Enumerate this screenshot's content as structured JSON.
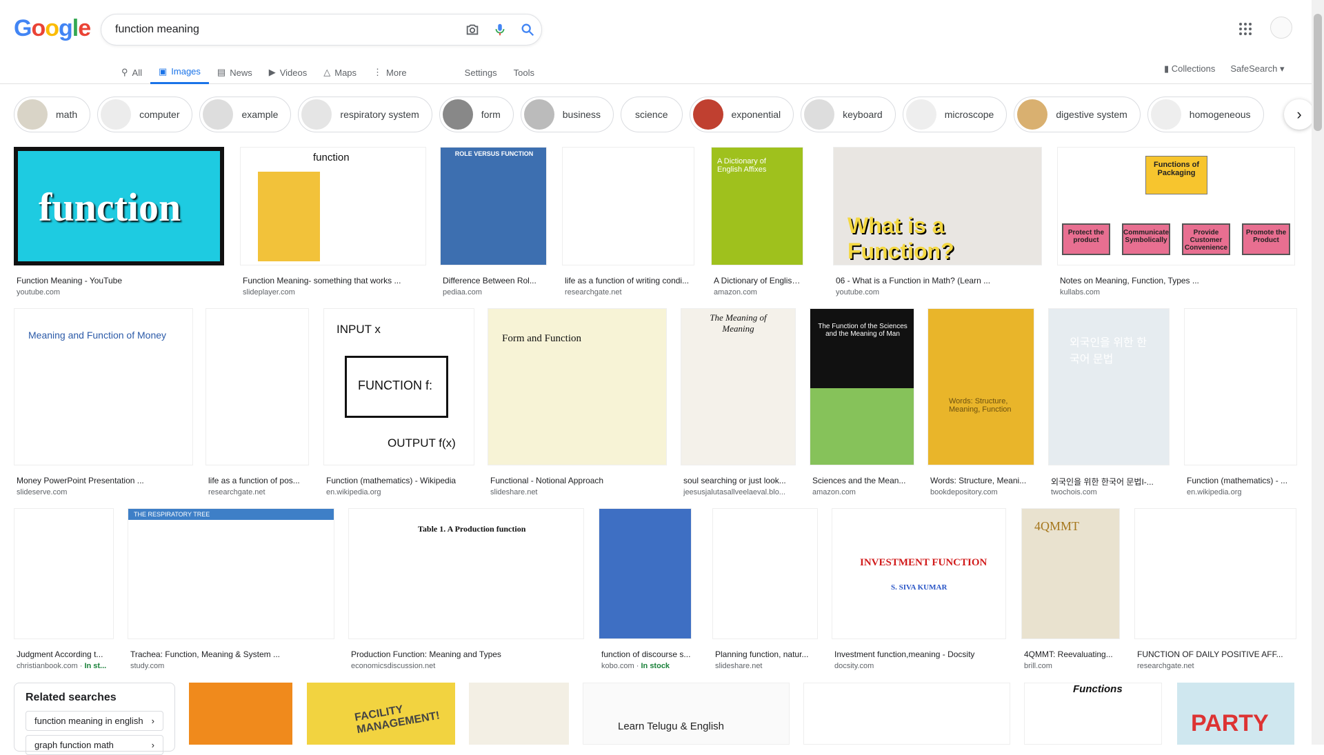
{
  "logo": {
    "letters": [
      "G",
      "o",
      "o",
      "g",
      "l",
      "e"
    ],
    "colors": [
      "#4285F4",
      "#EA4335",
      "#FBBC05",
      "#4285F4",
      "#34A853",
      "#EA4335"
    ]
  },
  "search": {
    "query": "function meaning"
  },
  "tabs": [
    {
      "label": "All",
      "icon": "search-icon"
    },
    {
      "label": "Images",
      "icon": "image-icon",
      "active": true
    },
    {
      "label": "News",
      "icon": "news-icon"
    },
    {
      "label": "Videos",
      "icon": "video-icon"
    },
    {
      "label": "Maps",
      "icon": "map-icon"
    },
    {
      "label": "More",
      "icon": "more-vert-icon"
    }
  ],
  "tools": {
    "settings": "Settings",
    "tools": "Tools",
    "collections": "Collections",
    "safesearch": "SafeSearch"
  },
  "chips": [
    "math",
    "computer",
    "example",
    "respiratory system",
    "form",
    "business",
    "science",
    "exponential",
    "keyboard",
    "microscope",
    "digestive system",
    "homogeneous"
  ],
  "results": [
    {
      "title": "Function Meaning - YouTube",
      "src": "youtube.com"
    },
    {
      "title": "Function Meaning- something that works ...",
      "src": "slideplayer.com"
    },
    {
      "title": "Difference Between Rol...",
      "src": "pediaa.com"
    },
    {
      "title": "life as a function of writing condi...",
      "src": "researchgate.net"
    },
    {
      "title": "A Dictionary of English ...",
      "src": "amazon.com"
    },
    {
      "title": "06 - What is a Function in Math? (Learn ...",
      "src": "youtube.com"
    },
    {
      "title": "Notes on Meaning, Function, Types ...",
      "src": "kullabs.com"
    },
    {
      "title": "Money PowerPoint Presentation ...",
      "src": "slideserve.com"
    },
    {
      "title": "life as a function of pos...",
      "src": "researchgate.net"
    },
    {
      "title": "Function (mathematics) - Wikipedia",
      "src": "en.wikipedia.org"
    },
    {
      "title": "Functional - Notional Approach",
      "src": "slideshare.net"
    },
    {
      "title": "soul searching or just look...",
      "src": "jeesusjalutasallveelaeval.blo..."
    },
    {
      "title": "Sciences and the Mean...",
      "src": "amazon.com"
    },
    {
      "title": "Words: Structure, Meani...",
      "src": "bookdepository.com"
    },
    {
      "title": "외국인을 위한 한국어 문법I-...",
      "src": "twochois.com"
    },
    {
      "title": "Function (mathematics) - ...",
      "src": "en.wikipedia.org"
    },
    {
      "title": "Judgment According t...",
      "src": "christianbook.com",
      "stock": "In st..."
    },
    {
      "title": "Trachea: Function, Meaning & System ...",
      "src": "study.com"
    },
    {
      "title": "Production Function: Meaning and Types",
      "src": "economicsdiscussion.net"
    },
    {
      "title": "function of discourse s...",
      "src": "kobo.com",
      "stock": "In stock"
    },
    {
      "title": "Planning function, natur...",
      "src": "slideshare.net"
    },
    {
      "title": "Investment function,meaning - Docsity",
      "src": "docsity.com"
    },
    {
      "title": "4QMMT: Reevaluating...",
      "src": "brill.com"
    },
    {
      "title": "FUNCTION OF DAILY POSITIVE AFF...",
      "src": "researchgate.net"
    }
  ],
  "image_text": {
    "r1": "function",
    "r2": "function",
    "r3": "ROLE VERSUS FUNCTION",
    "r5": "A Dictionary of English Affixes",
    "r6": "What is a Function?",
    "r7_title": "Functions of Packaging",
    "r7_boxes": [
      "Protect the product",
      "Communicate Symbolically",
      "Provide Customer Convenience",
      "Promote the Product"
    ],
    "r8": "Meaning and Function of Money",
    "r10_in": "INPUT x",
    "r10_fn": "FUNCTION f:",
    "r10_out": "OUTPUT f(x)",
    "r11": "Form and Function",
    "r12": "The Meaning of Meaning",
    "r13": "The Function of the Sciences and the Meaning of Man",
    "r14": "Words: Structure, Meaning, Function",
    "r15": "외국인을 위한 한국어 문법",
    "r18": "THE RESPIRATORY TREE",
    "r19": "Table 1. A Production function",
    "r22": "INVESTMENT FUNCTION",
    "r22b": "S. SIVA KUMAR",
    "r23": "4QMMT",
    "b4": "Learn Telugu & English",
    "b6": "Functions",
    "b7": "PARTY",
    "b2": "FACILITY MANAGEMENT!"
  },
  "related": {
    "heading": "Related searches",
    "items": [
      "function meaning in english",
      "graph function math"
    ]
  }
}
